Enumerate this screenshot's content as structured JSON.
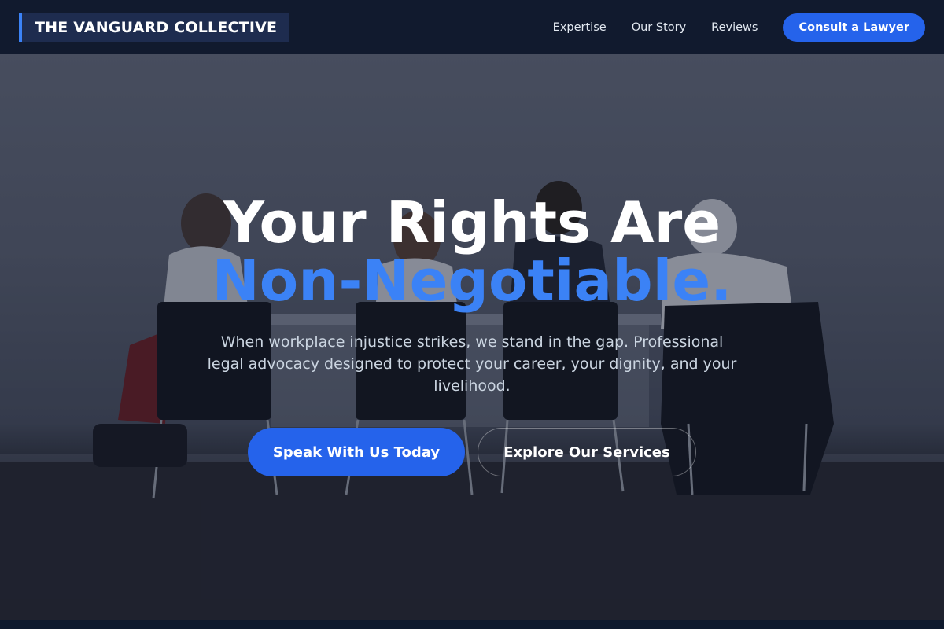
{
  "navbar": {
    "brand": "THE VANGUARD COLLECTIVE",
    "links": [
      {
        "label": "Expertise"
      },
      {
        "label": "Our Story"
      },
      {
        "label": "Reviews"
      }
    ],
    "cta_label": "Consult a Lawyer"
  },
  "hero": {
    "headline": "Your Rights Are",
    "headline_accent": "Non-Negotiable.",
    "subtitle": "When workplace injustice strikes, we stand in the gap. Professional legal advocacy designed to protect your career, your dignity, and your livelihood.",
    "primary_button": "Speak With Us Today",
    "secondary_button": "Explore Our Services",
    "background_image": "office-people-seated-at-table-photo"
  },
  "colors": {
    "accent": "#3b82f6",
    "button": "#2563eb",
    "navbar_bg": "#111a2e",
    "brand_bg": "#1e2c4f"
  }
}
